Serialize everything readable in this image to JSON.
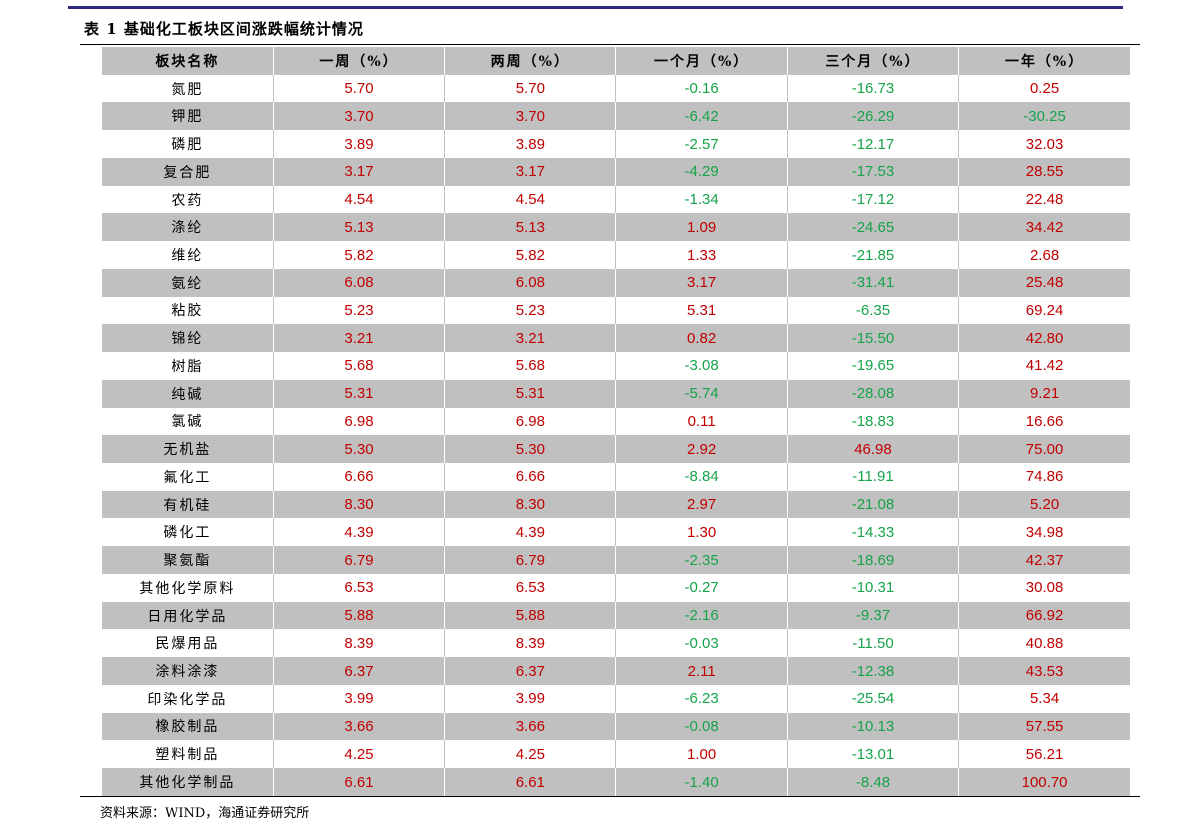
{
  "caption": "表 1 基础化工板块区间涨跌幅统计情况",
  "columns": [
    "板块名称",
    "一周（%）",
    "两周（%）",
    "一个月（%）",
    "三个月（%）",
    "一年（%）"
  ],
  "colors": {
    "positive": "#c00000",
    "negative": "#16a34a",
    "header_bg": "#c0c0c0"
  },
  "rows": [
    [
      "氮肥",
      "5.70",
      "5.70",
      "-0.16",
      "-16.73",
      "0.25"
    ],
    [
      "钾肥",
      "3.70",
      "3.70",
      "-6.42",
      "-26.29",
      "-30.25"
    ],
    [
      "磷肥",
      "3.89",
      "3.89",
      "-2.57",
      "-12.17",
      "32.03"
    ],
    [
      "复合肥",
      "3.17",
      "3.17",
      "-4.29",
      "-17.53",
      "28.55"
    ],
    [
      "农药",
      "4.54",
      "4.54",
      "-1.34",
      "-17.12",
      "22.48"
    ],
    [
      "涤纶",
      "5.13",
      "5.13",
      "1.09",
      "-24.65",
      "34.42"
    ],
    [
      "维纶",
      "5.82",
      "5.82",
      "1.33",
      "-21.85",
      "2.68"
    ],
    [
      "氨纶",
      "6.08",
      "6.08",
      "3.17",
      "-31.41",
      "25.48"
    ],
    [
      "粘胶",
      "5.23",
      "5.23",
      "5.31",
      "-6.35",
      "69.24"
    ],
    [
      "锦纶",
      "3.21",
      "3.21",
      "0.82",
      "-15.50",
      "42.80"
    ],
    [
      "树脂",
      "5.68",
      "5.68",
      "-3.08",
      "-19.65",
      "41.42"
    ],
    [
      "纯碱",
      "5.31",
      "5.31",
      "-5.74",
      "-28.08",
      "9.21"
    ],
    [
      "氯碱",
      "6.98",
      "6.98",
      "0.11",
      "-18.83",
      "16.66"
    ],
    [
      "无机盐",
      "5.30",
      "5.30",
      "2.92",
      "46.98",
      "75.00"
    ],
    [
      "氟化工",
      "6.66",
      "6.66",
      "-8.84",
      "-11.91",
      "74.86"
    ],
    [
      "有机硅",
      "8.30",
      "8.30",
      "2.97",
      "-21.08",
      "5.20"
    ],
    [
      "磷化工",
      "4.39",
      "4.39",
      "1.30",
      "-14.33",
      "34.98"
    ],
    [
      "聚氨酯",
      "6.79",
      "6.79",
      "-2.35",
      "-18.69",
      "42.37"
    ],
    [
      "其他化学原料",
      "6.53",
      "6.53",
      "-0.27",
      "-10.31",
      "30.08"
    ],
    [
      "日用化学品",
      "5.88",
      "5.88",
      "-2.16",
      "-9.37",
      "66.92"
    ],
    [
      "民爆用品",
      "8.39",
      "8.39",
      "-0.03",
      "-11.50",
      "40.88"
    ],
    [
      "涂料涂漆",
      "6.37",
      "6.37",
      "2.11",
      "-12.38",
      "43.53"
    ],
    [
      "印染化学品",
      "3.99",
      "3.99",
      "-6.23",
      "-25.54",
      "5.34"
    ],
    [
      "橡胶制品",
      "3.66",
      "3.66",
      "-0.08",
      "-10.13",
      "57.55"
    ],
    [
      "塑料制品",
      "4.25",
      "4.25",
      "1.00",
      "-13.01",
      "56.21"
    ],
    [
      "其他化学制品",
      "6.61",
      "6.61",
      "-1.40",
      "-8.48",
      "100.70"
    ]
  ],
  "source": "资料来源：WIND，海通证券研究所"
}
